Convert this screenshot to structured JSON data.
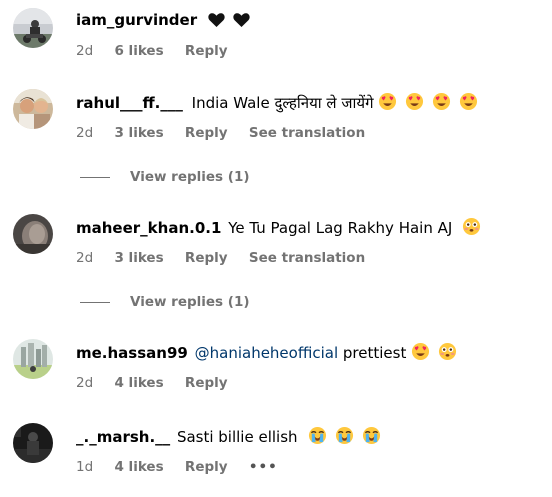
{
  "comments": [
    {
      "username": "iam_gurvinder",
      "text": "",
      "emojis": [
        "black-heart",
        "black-heart"
      ],
      "time": "2d",
      "likes": "6 likes",
      "reply": "Reply"
    },
    {
      "username": "rahul___ff.___",
      "text": "India Wale दुल्हनिया ले जायेंगे",
      "emojis": [
        "heart-eyes",
        "heart-eyes",
        "heart-eyes",
        "heart-eyes"
      ],
      "time": "2d",
      "likes": "3 likes",
      "reply": "Reply",
      "see_translation": "See translation",
      "view_replies": "View replies (1)"
    },
    {
      "username": "maheer_khan.0.1",
      "text": "Ye Tu Pagal Lag Rakhy Hain AJ",
      "emojis": [
        "flushed"
      ],
      "time": "2d",
      "likes": "3 likes",
      "reply": "Reply",
      "see_translation": "See translation",
      "view_replies": "View replies (1)"
    },
    {
      "username": "me.hassan99",
      "mention": "@haniaheheofficial",
      "text": "prettiest",
      "emojis": [
        "heart-eyes",
        "flushed"
      ],
      "time": "2d",
      "likes": "4 likes",
      "reply": "Reply"
    },
    {
      "username": "_._marsh.__",
      "text": "Sasti billie ellish",
      "emojis": [
        "crying",
        "crying",
        "crying"
      ],
      "time": "1d",
      "likes": "4 likes",
      "reply": "Reply",
      "more": "•••"
    }
  ],
  "colors": {
    "username": "#000000",
    "meta": "#737373",
    "mention": "#00376b"
  }
}
